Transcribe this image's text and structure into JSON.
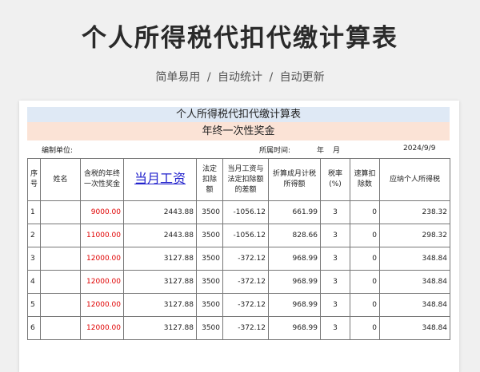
{
  "header": {
    "title": "个人所得税代扣代缴计算表",
    "features": [
      "简单易用",
      "自动统计",
      "自动更新"
    ],
    "separator": "/"
  },
  "sheet": {
    "title": "个人所得税代扣代缴计算表",
    "subtitle": "年终一次性奖金",
    "unit_label": "编制单位:",
    "period_label": "所属时间:",
    "year_label": "年",
    "month_label": "月",
    "date": "2024/9/9",
    "columns": [
      "序号",
      "姓名",
      "含税的年终一次性奖金",
      "当月工资",
      "法定扣除额",
      "当月工资与法定扣除额的差额",
      "折算成月计税所得额",
      "税率(%)",
      "速算扣除数",
      "应纳个人所得税"
    ],
    "rows": [
      [
        "1",
        "",
        "9000.00",
        "2443.88",
        "3500",
        "-1056.12",
        "661.99",
        "3",
        "0",
        "238.32"
      ],
      [
        "2",
        "",
        "11000.00",
        "2443.88",
        "3500",
        "-1056.12",
        "828.66",
        "3",
        "0",
        "298.32"
      ],
      [
        "3",
        "",
        "12000.00",
        "3127.88",
        "3500",
        "-372.12",
        "968.99",
        "3",
        "0",
        "348.84"
      ],
      [
        "4",
        "",
        "12000.00",
        "3127.88",
        "3500",
        "-372.12",
        "968.99",
        "3",
        "0",
        "348.84"
      ],
      [
        "5",
        "",
        "12000.00",
        "3127.88",
        "3500",
        "-372.12",
        "968.99",
        "3",
        "0",
        "348.84"
      ],
      [
        "6",
        "",
        "12000.00",
        "3127.88",
        "3500",
        "-372.12",
        "968.99",
        "3",
        "0",
        "348.84"
      ]
    ]
  }
}
